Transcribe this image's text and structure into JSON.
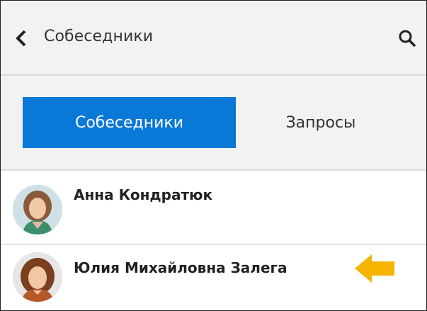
{
  "header": {
    "back_icon": "chevron-left-icon",
    "title": "Собеседники",
    "search_icon": "search-icon"
  },
  "tabs": [
    {
      "label": "Собеседники",
      "active": true
    },
    {
      "label": "Запросы",
      "active": false
    }
  ],
  "contacts": [
    {
      "name": "Анна Кондратюк"
    },
    {
      "name": "Юлия Михайловна Залега"
    }
  ],
  "colors": {
    "accent": "#0a78d7",
    "header_bg": "#f2f2f2",
    "pointer_arrow": "#f5b400"
  },
  "annotation": {
    "icon": "arrow-left-icon"
  }
}
